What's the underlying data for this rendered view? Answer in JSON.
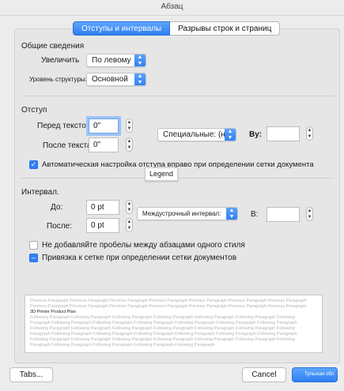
{
  "window": {
    "title": "Абзац"
  },
  "tabs": [
    {
      "label": "Отступы и интервалы"
    },
    {
      "label": "Разрывы строк и страниц"
    }
  ],
  "general": {
    "heading": "Общие сведения",
    "alignment_label": "Увеличить",
    "alignment_value": "По левому краю",
    "outline_label": "Уровень структуры:",
    "outline_value": "Основной текст"
  },
  "indent": {
    "heading": "Отступ",
    "before_label": "Перед текстом:",
    "before_value": "0\"",
    "after_label": "После текста:",
    "after_value": "0\"",
    "special_label": "Специальные: (нет)",
    "by_label": "By:",
    "by_value": "",
    "auto_adjust_label": "Автоматическая настройка отступа вправо при определении сетки документа"
  },
  "tooltip": {
    "text": "Legend"
  },
  "spacing": {
    "heading": "Интервал.",
    "before_label": "До:",
    "before_value": "0 pt",
    "after_label": "После:",
    "after_value": "0 pt",
    "line_label": "Междустрочный интервал: _Single",
    "at_label": "В:",
    "at_value": "",
    "no_space_label": "Не добавляйте пробелы между абзацами одного стиля",
    "snap_grid_label": "Привязка к сетке при определении сетки документов"
  },
  "preview": {
    "previous": [
      "Previous Paragraph Previous Paragraph Previous Paragraph Previous Paragraph Previous Paragraph Previous Paragraph Previous Paragraph",
      "Previous Paragraph Previous Paragraph Previous Paragraph Previous Paragraph Previous Paragraph Previous Paragraph Previous Paragraph"
    ],
    "current": "3D Printer Product Plan",
    "following": [
      "Following Paragraph Following Paragraph Following Paragraph Following Paragraph Following Paragraph Following Paragraph Following",
      "Paragraph Following Paragraph Following Paragraph Following Paragraph Following Paragraph Following Paragraph Following Paragraph",
      "Following Paragraph Following Paragraph Following Paragraph Following Paragraph Following Paragraph Following Paragraph Following",
      "Paragraph Following Paragraph Following Paragraph Following Paragraph Following Paragraph Following Paragraph Following Paragraph",
      "Following Paragraph Following Paragraph Following Paragraph Following Paragraph Following Paragraph Following Paragraph Following",
      "Paragraph Following Paragraph Following Paragraph Following Paragraph Following Paragraph"
    ]
  },
  "footer": {
    "tabs_button": "Tabs...",
    "cancel_button": "Cancel",
    "ok_button": "Тульская обл"
  },
  "icons": {
    "select_arrows": "up-down-chevron-icon",
    "stepper": "stepper-icon",
    "checkmark": "checkmark-icon"
  },
  "colors": {
    "accent": "#2e7ff5",
    "panel": "#e6e6e6",
    "background": "#ececec"
  }
}
